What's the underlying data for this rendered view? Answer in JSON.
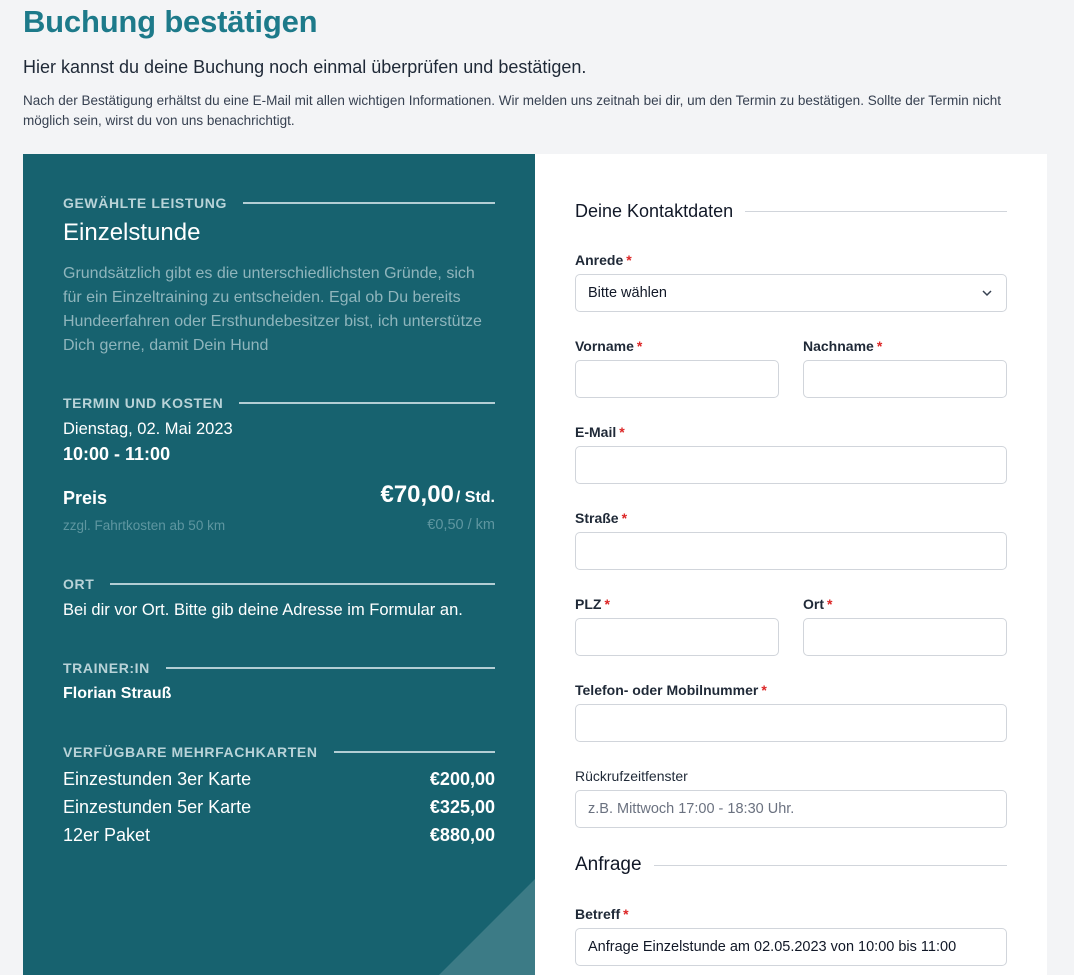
{
  "header": {
    "title": "Buchung bestätigen",
    "subtitle": "Hier kannst du deine Buchung noch einmal überprüfen und bestätigen.",
    "intro": "Nach der Bestätigung erhältst du eine E-Mail mit allen wichtigen Informationen. Wir melden uns zeitnah bei dir, um den Termin zu bestätigen. Sollte der Termin nicht möglich sein, wirst du von uns benachrichtigt."
  },
  "summary": {
    "service_heading": "GEWÄHLTE LEISTUNG",
    "service_name": "Einzelstunde",
    "service_description": "Grundsätzlich gibt es die unterschiedlichsten Gründe, sich für ein Einzeltraining zu entscheiden. Egal ob Du bereits Hundeerfahren oder Ersthundebesitzer bist, ich unterstütze Dich gerne, damit Dein Hund",
    "schedule_heading": "TERMIN UND KOSTEN",
    "date": "Dienstag, 02. Mai 2023",
    "time": "10:00 - 11:00",
    "price_label": "Preis",
    "price": "€70,00",
    "price_unit": "/ Std.",
    "travel_label": "zzgl. Fahrtkosten ab 50 km",
    "travel_price": "€0,50 / km",
    "location_heading": "ORT",
    "location": "Bei dir vor Ort. Bitte gib deine Adresse im Formular an.",
    "trainer_heading": "TRAINER:IN",
    "trainer": "Florian Strauß",
    "multi_heading": "VERFÜGBARE MEHRFACHKARTEN",
    "multi_cards": [
      {
        "name": "Einzestunden 3er Karte",
        "price": "€200,00"
      },
      {
        "name": "Einzestunden 5er Karte",
        "price": "€325,00"
      },
      {
        "name": "12er Paket",
        "price": "€880,00"
      }
    ]
  },
  "form": {
    "contact_heading": "Deine Kontaktdaten",
    "required_mark": "*",
    "salutation": {
      "label": "Anrede",
      "value": "Bitte wählen"
    },
    "first_name": {
      "label": "Vorname",
      "value": ""
    },
    "last_name": {
      "label": "Nachname",
      "value": ""
    },
    "email": {
      "label": "E-Mail",
      "value": ""
    },
    "street": {
      "label": "Straße",
      "value": ""
    },
    "zip": {
      "label": "PLZ",
      "value": ""
    },
    "city": {
      "label": "Ort",
      "value": ""
    },
    "phone": {
      "label": "Telefon- oder Mobilnummer",
      "value": ""
    },
    "callback": {
      "label": "Rückrufzeitfenster",
      "value": "",
      "placeholder": "z.B. Mittwoch 17:00 - 18:30 Uhr."
    },
    "request_heading": "Anfrage",
    "subject": {
      "label": "Betreff",
      "value": "Anfrage Einzelstunde am 02.05.2023 von 10:00 bis 11:00"
    }
  },
  "colors": {
    "accent": "#1d7a8a",
    "panel": "#17626f",
    "required": "#dc2626"
  }
}
